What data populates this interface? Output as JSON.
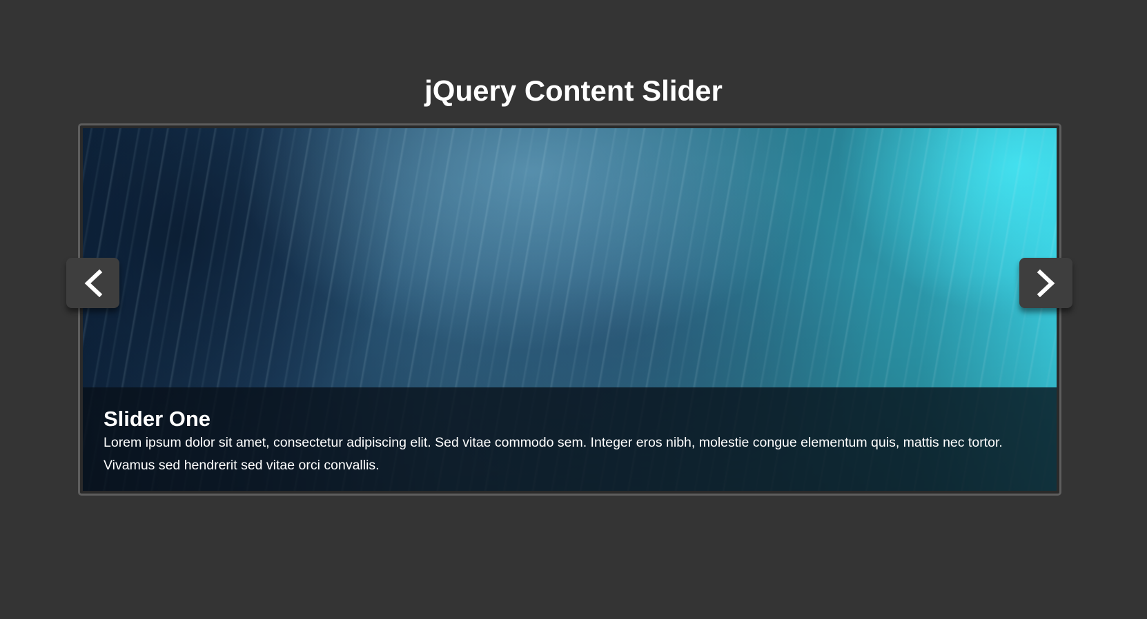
{
  "page": {
    "title": "jQuery Content Slider"
  },
  "slider": {
    "prev_icon": "chevron-left-icon",
    "next_icon": "chevron-right-icon",
    "current_slide": {
      "title": "Slider One",
      "text": "Lorem ipsum dolor sit amet, consectetur adipiscing elit. Sed vitae commodo sem. Integer eros nibh, molestie congue elementum quis, mattis nec tortor. Vivamus sed hendrerit sed vitae orci convallis."
    }
  },
  "colors": {
    "background": "#343434",
    "frame_border": "#5e5e5e",
    "nav_button": "#3e3e3e",
    "text": "#ffffff"
  }
}
